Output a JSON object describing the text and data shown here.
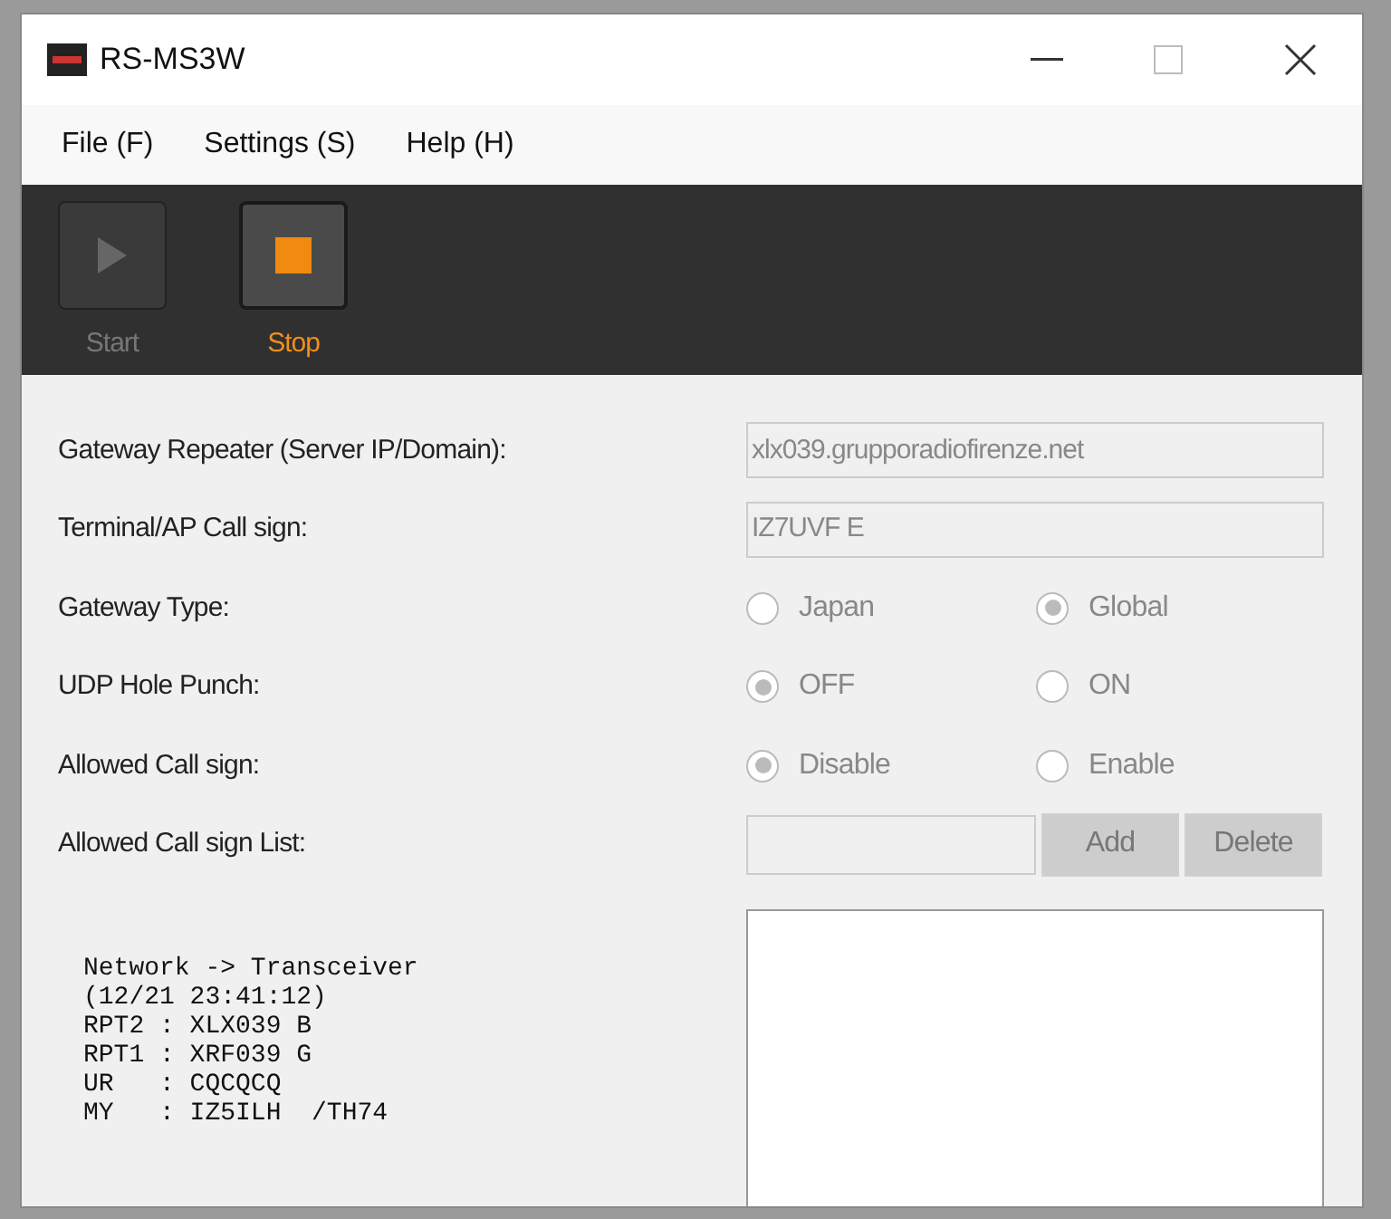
{
  "window": {
    "title": "RS-MS3W"
  },
  "menu": [
    "File (F)",
    "Settings (S)",
    "Help (H)"
  ],
  "toolbar": [
    {
      "kind": "start",
      "label": "Start",
      "disabled": true
    },
    {
      "kind": "stop",
      "label": "Stop",
      "disabled": false
    }
  ],
  "form": [
    {
      "kind": "text",
      "label": "Gateway Repeater (Server IP/Domain):",
      "value": "xlx039.grupporadiofirenze.net",
      "disabled": true
    },
    {
      "kind": "text",
      "label": "Terminal/AP Call sign:",
      "value": "IZ7UVF E",
      "disabled": true
    },
    {
      "kind": "radio",
      "label": "Gateway Type:",
      "disabled": true,
      "options": [
        {
          "label": "Japan",
          "selected": false
        },
        {
          "label": "Global",
          "selected": true
        }
      ]
    },
    {
      "kind": "radio",
      "label": "UDP Hole Punch:",
      "disabled": true,
      "options": [
        {
          "label": "OFF",
          "selected": true
        },
        {
          "label": "ON",
          "selected": false
        }
      ]
    },
    {
      "kind": "radio",
      "label": "Allowed Call sign:",
      "disabled": true,
      "options": [
        {
          "label": "Disable",
          "selected": true
        },
        {
          "label": "Enable",
          "selected": false
        }
      ]
    },
    {
      "kind": "list_input",
      "label": "Allowed Call sign List:",
      "disabled": true,
      "buttons": [
        "Add",
        "Delete"
      ]
    }
  ],
  "log": [
    "Network -> Transceiver",
    "(12/21 23:41:12)",
    "RPT2 : XLX039 B",
    "RPT1 : XRF039 G",
    "UR   : CQCQCQ",
    "MY   : IZ5ILH  /TH74"
  ]
}
